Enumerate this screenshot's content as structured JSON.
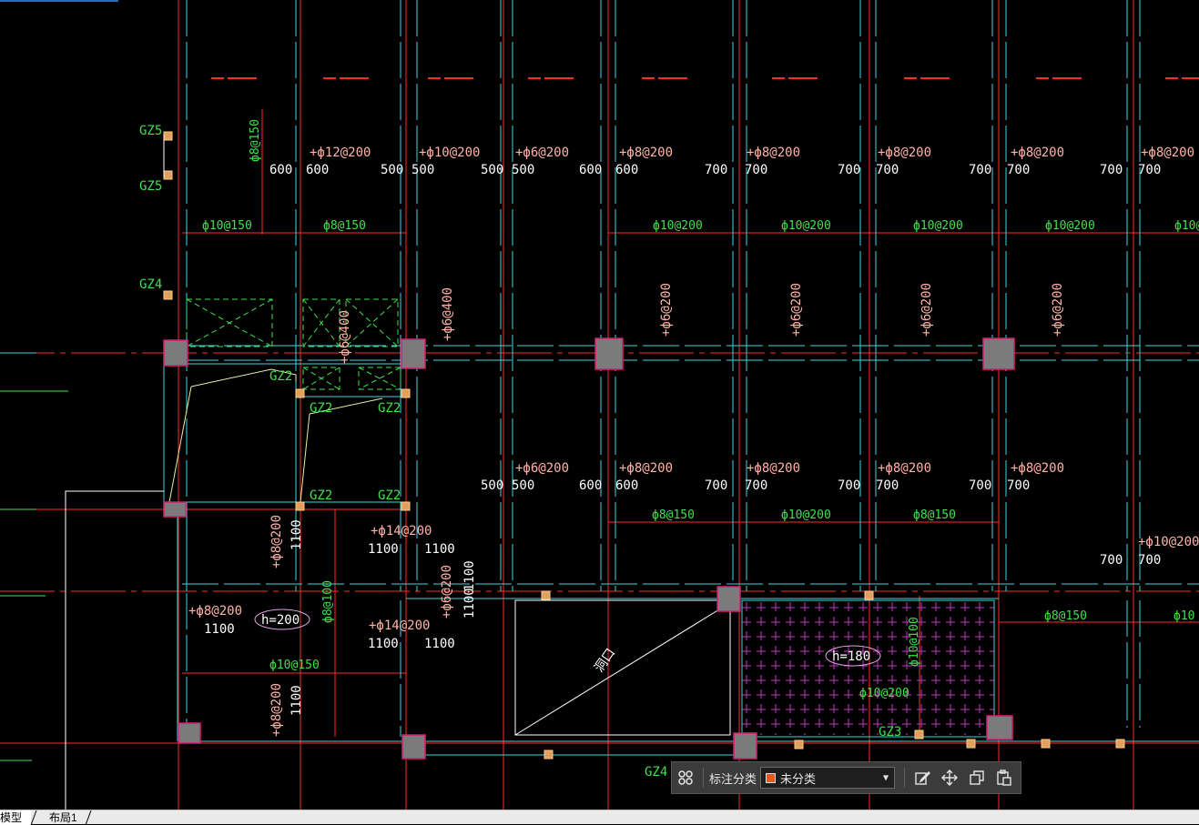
{
  "drawing": {
    "column_labels": [
      "GZ5",
      "GZ5",
      "GZ4",
      "GZ2",
      "GZ2",
      "GZ2",
      "GZ2",
      "GZ2",
      "GZ3",
      "GZ4"
    ],
    "rebar_labels_top": [
      "+ф12@200",
      "+ф10@200",
      "+ф6@200",
      "+ф8@200",
      "+ф8@200",
      "+ф8@200",
      "+ф8@200",
      "+ф8@200"
    ],
    "rebar_labels_mid": [
      "+ф6@200",
      "+ф8@200",
      "+ф8@200",
      "+ф8@200",
      "+ф8@200"
    ],
    "rebar_labels_other": [
      "+ф14@200",
      "+ф14@200",
      "+ф8@200",
      "+ф10@200"
    ],
    "vertical_labels": [
      "ф8@150",
      "+ф6@400",
      "+ф6@200",
      "+ф6@200",
      "+ф6@200",
      "+ф6@200",
      "+ф8@200",
      "ф8@100",
      "+ф6@200",
      "+ф8@200",
      "ф10@100",
      "+ф6@400"
    ],
    "bottom_span_labels": [
      "ф10@150",
      "ф8@150",
      "ф10@200",
      "ф10@200",
      "ф10@200",
      "ф10@200",
      "ф10@",
      "ф8@150",
      "ф10@200",
      "ф8@150",
      "ф10@150",
      "ф8@150",
      "ф10@200",
      "ф10"
    ],
    "dims_top": [
      "600",
      "600",
      "500",
      "500",
      "500",
      "500",
      "600",
      "600",
      "700",
      "700",
      "700",
      "700",
      "700",
      "700",
      "700",
      "700"
    ],
    "dims_mid": [
      "500",
      "500",
      "600",
      "600",
      "700",
      "700",
      "700",
      "700",
      "700",
      "700",
      "700",
      "700"
    ],
    "dims_other": [
      "1100",
      "1100",
      "1100",
      "1100",
      "1100",
      "1100",
      "1100",
      "1100",
      "1100",
      "500",
      "500",
      "600",
      "600",
      "700",
      "700",
      "700",
      "700",
      "700",
      "700",
      "500",
      "500",
      "500"
    ],
    "slab_thickness": [
      "h=200",
      "h=180"
    ],
    "opening_label": "洞口",
    "colors": {
      "red": "#ff2a2a",
      "cyan": "#3fd4e0",
      "green": "#3fe04a",
      "salmon": "#ffb3a6",
      "white": "#ffffff",
      "magenta": "#c03ac0",
      "column_fill": "#7b7b7b",
      "column_border": "#d81c74"
    }
  },
  "toolbar": {
    "layout_icon": "grid-layout-icon",
    "category_label": "标注分类",
    "category_value": "未分类",
    "category_swatch": "#e8571e",
    "dropdown_icon": "caret-down-icon",
    "tools": [
      "edit-icon",
      "move-icon",
      "copy-icon",
      "paste-icon"
    ]
  },
  "tabs": {
    "model": "模型",
    "layout": "布局1"
  }
}
